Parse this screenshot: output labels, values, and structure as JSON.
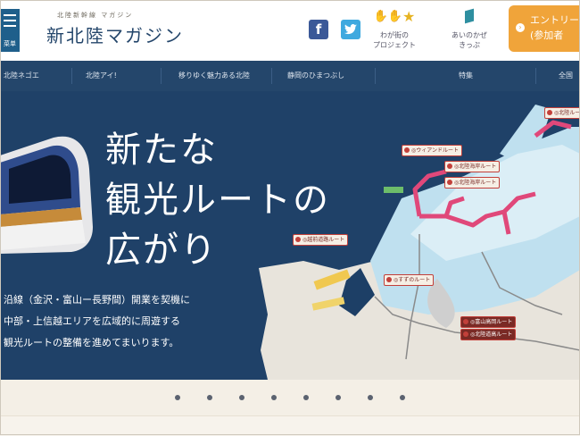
{
  "header": {
    "menu_label": "菜单",
    "logo_small": "北陸新幹線 マガジン",
    "logo_title": "新北陸マガジン",
    "social_fb": "f",
    "social_tw": "t",
    "link_project_label": "わが街の\nプロジェクト",
    "link_about_label": "あいのかぜ\nきっぷ",
    "entry_line1": "エントリー",
    "entry_line2": "(参加者"
  },
  "nav": {
    "items": [
      "北陸ネゴエ",
      "北陸アイ!",
      "移りゆく魅力ある北陸",
      "静岡のひまつぶし",
      "特集",
      "全国"
    ]
  },
  "hero": {
    "headline": [
      "新たな",
      "観光ルートの",
      "広がり"
    ],
    "description": [
      "沿線（金沢・富山ー長野間）開業を契機に",
      "中部・上信越エリアを広域的に周遊する",
      "観光ルートの整備を進めてまいります。"
    ],
    "route_tags": [
      "◎北陸ルート",
      "◎ウィアンドルート",
      "◎北陸海岸ルート",
      "◎越前道路ルート",
      "◎北陸海岸ルート",
      "◎すずのルート",
      "◎富山高岡ルート",
      "◎北陸道高ルート"
    ]
  },
  "slider": {
    "dot_count": 8
  },
  "colors": {
    "brand": "#24466b",
    "accent": "#f0a43a",
    "route": "#c2403a",
    "route_line": "#e0487a"
  }
}
